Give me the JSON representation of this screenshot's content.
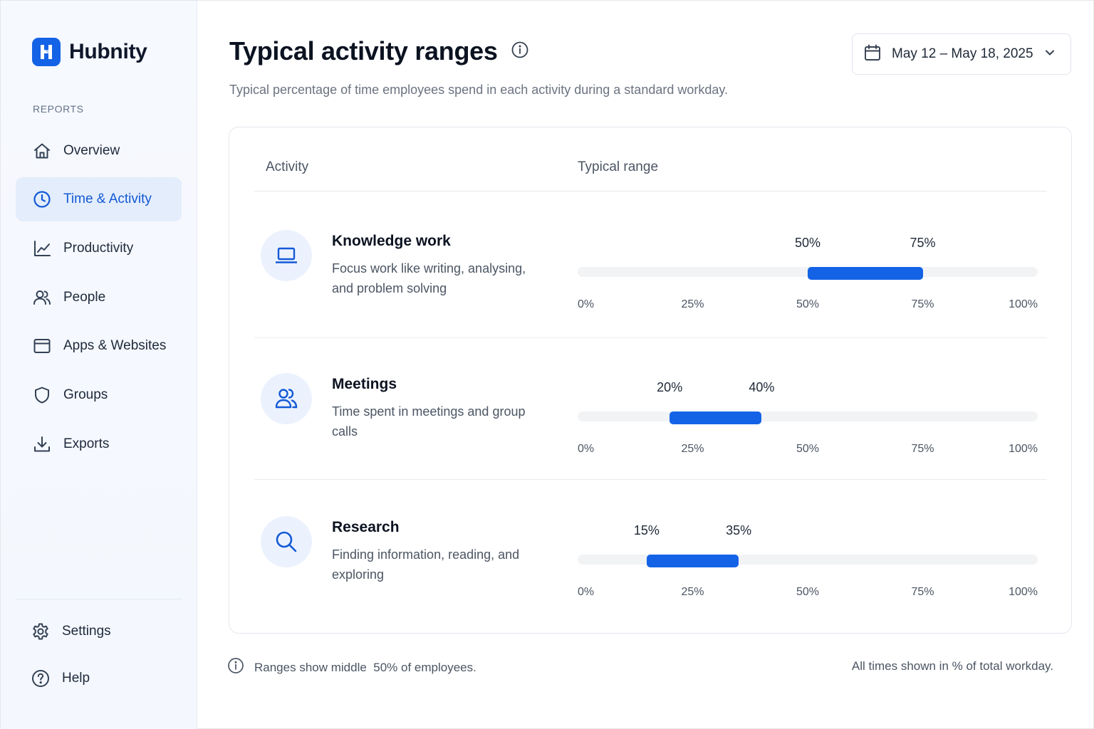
{
  "brand": {
    "name": "Hubnity",
    "accent": "#1463e6"
  },
  "sidebar": {
    "section_label": "REPORTS",
    "items": [
      {
        "label": "Overview",
        "icon": "home-icon",
        "active": false
      },
      {
        "label": "Time & Activity",
        "icon": "clock-icon",
        "active": true
      },
      {
        "label": "Productivity",
        "icon": "line-chart-icon",
        "active": false
      },
      {
        "label": "People",
        "icon": "users-icon",
        "active": false
      },
      {
        "label": "Apps & Websites",
        "icon": "browser-window-icon",
        "active": false
      },
      {
        "label": "Groups",
        "icon": "shield-icon",
        "active": false
      },
      {
        "label": "Exports",
        "icon": "download-icon",
        "active": false
      }
    ],
    "bottom_items": [
      {
        "label": "Settings",
        "icon": "gear-icon"
      },
      {
        "label": "Help",
        "icon": "help-circle-icon"
      }
    ]
  },
  "header": {
    "title": "Typical activity ranges",
    "subtitle": "Typical percentage of time employees spend in each activity during a standard workday.",
    "date_range": "May 12 – May 18, 2025"
  },
  "table": {
    "col_activity": "Activity",
    "col_range": "Typical range",
    "ticks": [
      "0%",
      "25%",
      "50%",
      "75%",
      "100%"
    ],
    "rows": [
      {
        "name": "Knowledge work",
        "description": "Focus work like writing, analysing, and problem solving",
        "icon": "laptop-icon",
        "low": 50,
        "high": 75,
        "low_label": "50%",
        "high_label": "75%"
      },
      {
        "name": "Meetings",
        "description": "Time spent in meetings and group calls",
        "icon": "users-icon",
        "low": 20,
        "high": 40,
        "low_label": "20%",
        "high_label": "40%"
      },
      {
        "name": "Research",
        "description": "Finding information, reading, and exploring",
        "icon": "search-icon",
        "low": 15,
        "high": 35,
        "low_label": "15%",
        "high_label": "35%"
      }
    ]
  },
  "footer": {
    "note": "Ranges show middle  50% of employees.",
    "right": "All times shown in % of total workday."
  }
}
